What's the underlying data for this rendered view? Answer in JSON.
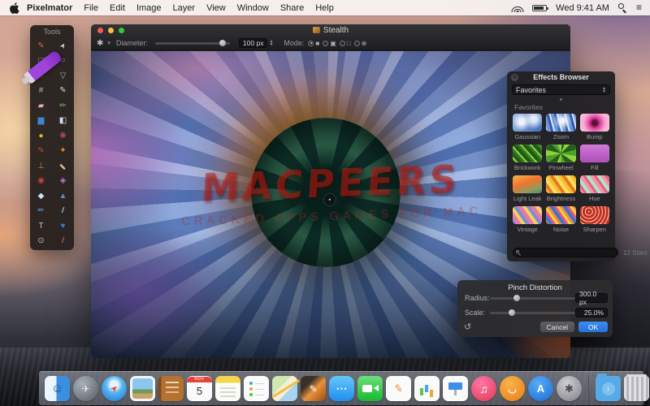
{
  "menu_bar": {
    "app_name": "Pixelmator",
    "items": [
      "File",
      "Edit",
      "Image",
      "Layer",
      "View",
      "Window",
      "Share",
      "Help"
    ],
    "status": {
      "time": "Wed 9:41 AM"
    }
  },
  "tools_panel": {
    "title": "Tools",
    "tools": [
      {
        "id": "paint",
        "glyph": "✎",
        "color": "#d2614c"
      },
      {
        "id": "move",
        "glyph": "➤",
        "color": "#c8c8c8"
      },
      {
        "id": "rect-select",
        "glyph": "□",
        "color": "#b0b0b0"
      },
      {
        "id": "ellipse-select",
        "glyph": "○",
        "color": "#b0b0b0"
      },
      {
        "id": "lasso",
        "glyph": "◌",
        "color": "#b0b0b0"
      },
      {
        "id": "poly-lasso",
        "glyph": "▽",
        "color": "#b0b0b0"
      },
      {
        "id": "crop",
        "glyph": "#",
        "color": "#b8b8b8"
      },
      {
        "id": "eyedropper",
        "glyph": "✎",
        "color": "#cfd8e0"
      },
      {
        "id": "eraser",
        "glyph": "▰",
        "color": "#e0a8b8"
      },
      {
        "id": "pencil",
        "glyph": "✏",
        "color": "#7fb86a"
      },
      {
        "id": "shape",
        "glyph": "▆",
        "color": "#3f86d2"
      },
      {
        "id": "paint-bucket",
        "glyph": "◧",
        "color": "#cfe0ee"
      },
      {
        "id": "ellipse-shape",
        "glyph": "●",
        "color": "#e5b22f"
      },
      {
        "id": "spray",
        "glyph": "❋",
        "color": "#cf5560"
      },
      {
        "id": "brush",
        "glyph": "✎",
        "color": "#c44a38"
      },
      {
        "id": "flame",
        "glyph": "✦",
        "color": "#e8862c"
      },
      {
        "id": "stamp",
        "glyph": "⊥",
        "color": "#d2873c"
      },
      {
        "id": "bandage",
        "glyph": "▬",
        "color": "#e0bc92"
      },
      {
        "id": "red-eye",
        "glyph": "◉",
        "color": "#c84040"
      },
      {
        "id": "patch",
        "glyph": "◈",
        "color": "#b678cc"
      },
      {
        "id": "drop",
        "glyph": "◆",
        "color": "#cfe2f2"
      },
      {
        "id": "sharpen-tool",
        "glyph": "▲",
        "color": "#5d88ca"
      },
      {
        "id": "blue-pencil",
        "glyph": "✏",
        "color": "#6f9ad8"
      },
      {
        "id": "smudge",
        "glyph": "/",
        "color": "#a8bcd8"
      },
      {
        "id": "type",
        "glyph": "T",
        "color": "#c4c4c4"
      },
      {
        "id": "heart",
        "glyph": "♥",
        "color": "#2f7ce0"
      },
      {
        "id": "zoom-tool",
        "glyph": "⊙",
        "color": "#c0c0c0"
      },
      {
        "id": "slice",
        "glyph": "/",
        "color": "#cf5550"
      }
    ]
  },
  "document_window": {
    "title": "Stealth",
    "toolbar": {
      "gear_glyph": "✱",
      "diameter_label": "Diameter:",
      "diameter_value": "100 px",
      "diameter_percent": 90,
      "mode_label": "Mode:",
      "modes": [
        {
          "id": "normal",
          "glyph": "■",
          "selected": true
        },
        {
          "id": "add",
          "glyph": "▣",
          "selected": false
        },
        {
          "id": "subtract",
          "glyph": "□",
          "selected": false
        },
        {
          "id": "intersect",
          "glyph": "⊕",
          "selected": false
        }
      ]
    }
  },
  "watermark": {
    "line1": "MACPEERS",
    "line2": "CRACKED APPS GAMES FOR MAC"
  },
  "effects_browser": {
    "title": "Effects Browser",
    "close_glyph": "✕",
    "dropdown_value": "Favorites",
    "section_label": "Favorites",
    "effects": [
      {
        "id": "gaussian",
        "label": "Gaussian"
      },
      {
        "id": "zoom",
        "label": "Zoom"
      },
      {
        "id": "bump",
        "label": "Bump"
      },
      {
        "id": "brickwork",
        "label": "Brickwork"
      },
      {
        "id": "pinwheel",
        "label": "Pinwheel"
      },
      {
        "id": "fill",
        "label": "Fill"
      },
      {
        "id": "lightleak",
        "label": "Light Leak"
      },
      {
        "id": "brightness",
        "label": "Brightness"
      },
      {
        "id": "hue",
        "label": "Hue"
      },
      {
        "id": "vintage",
        "label": "Vintage"
      },
      {
        "id": "noise",
        "label": "Noise"
      },
      {
        "id": "sharpen",
        "label": "Sharpen"
      }
    ],
    "footer": {
      "count_label": "12 Stars",
      "search_placeholder": ""
    }
  },
  "pinch_panel": {
    "title": "Pinch Distortion",
    "radius_label": "Radius:",
    "radius_value": "300.0 px",
    "radius_percent": 31,
    "scale_label": "Scale:",
    "scale_value": "25.0%",
    "scale_percent": 26,
    "reset_glyph": "↺",
    "cancel_label": "Cancel",
    "ok_label": "OK"
  },
  "dock": {
    "calendar": {
      "month": "NOV",
      "day": "5"
    },
    "apps": [
      {
        "id": "finder",
        "glyph": "☺",
        "running": true
      },
      {
        "id": "launchpad",
        "glyph": "✈",
        "running": false
      },
      {
        "id": "safari",
        "glyph": "➤",
        "running": false
      },
      {
        "id": "photos",
        "glyph": "",
        "running": false
      },
      {
        "id": "contacts",
        "glyph": "",
        "running": false
      },
      {
        "id": "calendar",
        "glyph": "",
        "running": false
      },
      {
        "id": "notes",
        "glyph": "",
        "running": false
      },
      {
        "id": "reminders",
        "glyph": "",
        "running": false
      },
      {
        "id": "maps",
        "glyph": "",
        "running": false
      },
      {
        "id": "pixelmator",
        "glyph": "✎",
        "running": true
      },
      {
        "id": "messages",
        "glyph": "⋯",
        "running": false
      },
      {
        "id": "facetime",
        "glyph": "",
        "running": false
      },
      {
        "id": "pages",
        "glyph": "✎",
        "running": false
      },
      {
        "id": "numbers",
        "glyph": "",
        "running": false
      },
      {
        "id": "keynote",
        "glyph": "",
        "running": false
      },
      {
        "id": "itunes",
        "glyph": "♫",
        "running": false
      },
      {
        "id": "ibooks",
        "glyph": "◡",
        "running": false
      },
      {
        "id": "appstore",
        "glyph": "A",
        "running": false
      },
      {
        "id": "sysprefs",
        "glyph": "✱",
        "running": false
      },
      {
        "id": "separator",
        "glyph": "",
        "running": false
      },
      {
        "id": "downloads",
        "glyph": "↓",
        "running": false
      },
      {
        "id": "trash",
        "glyph": "",
        "running": false
      }
    ]
  }
}
